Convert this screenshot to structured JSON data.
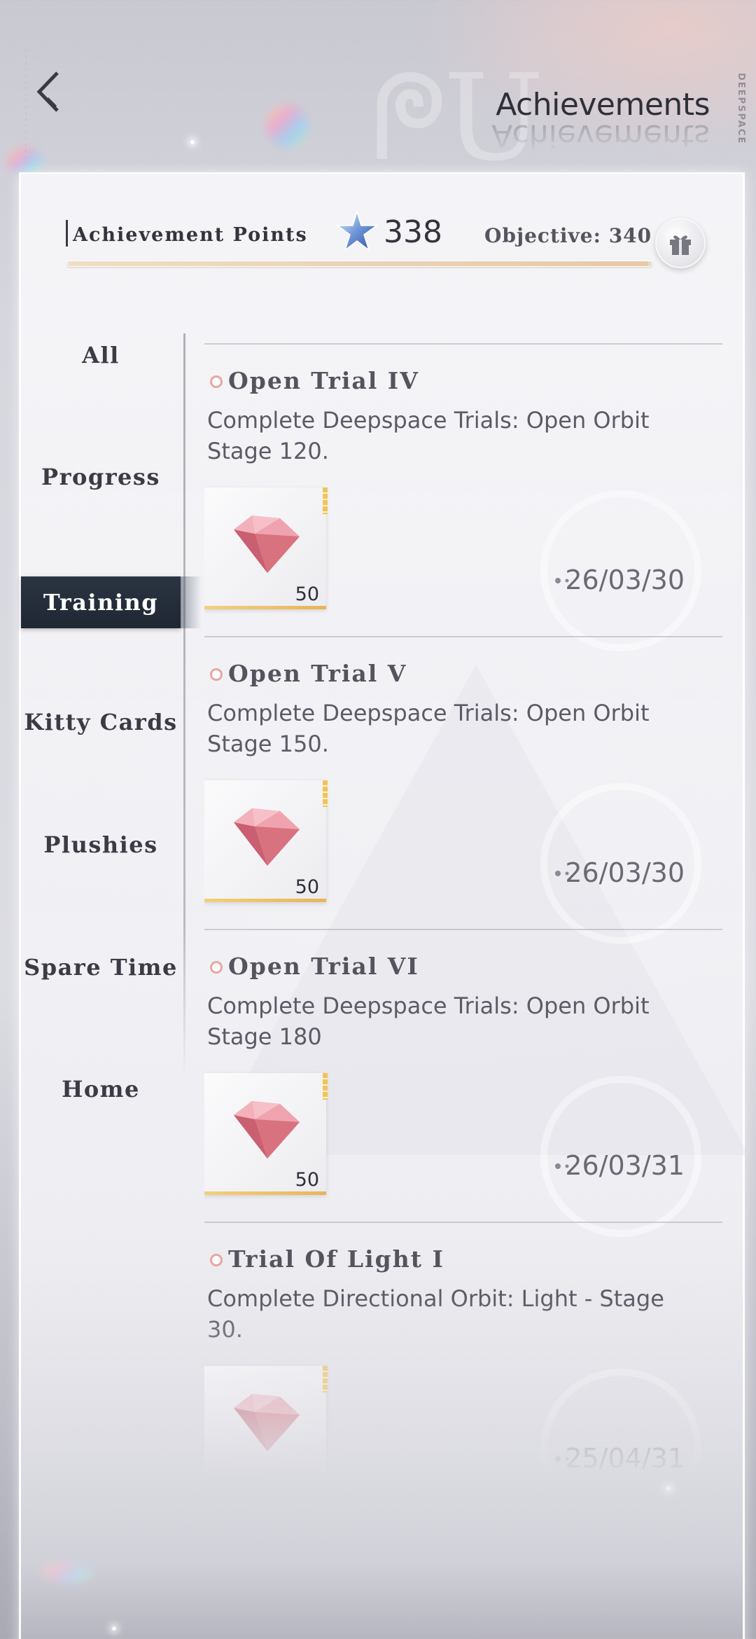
{
  "header": {
    "title": "Achievements",
    "brand": "DEEPSPACE"
  },
  "points": {
    "label": "Achievement Points",
    "value": "338",
    "objective": "Objective: 340",
    "progress_fraction": 0.994
  },
  "nav": {
    "items": [
      {
        "label": "All",
        "active": false
      },
      {
        "label": "Progress",
        "active": false
      },
      {
        "label": "Training",
        "active": true
      },
      {
        "label": "Kitty Cards",
        "active": false
      },
      {
        "label": "Plushies",
        "active": false
      },
      {
        "label": "Spare Time",
        "active": false
      },
      {
        "label": "Home",
        "active": false
      }
    ]
  },
  "achievements": [
    {
      "title": "Open Trial IV",
      "description": "Complete Deepspace Trials: Open Orbit Stage 120.",
      "reward_qty": "50",
      "reward_icon": "pink-diamond-icon",
      "date": "26/03/30"
    },
    {
      "title": "Open Trial V",
      "description": "Complete Deepspace Trials: Open Orbit Stage 150.",
      "reward_qty": "50",
      "reward_icon": "pink-diamond-icon",
      "date": "26/03/30"
    },
    {
      "title": "Open Trial VI",
      "description": "Complete Deepspace Trials: Open Orbit Stage 180",
      "reward_qty": "50",
      "reward_icon": "pink-diamond-icon",
      "date": "26/03/31"
    },
    {
      "title": "Trial Of Light I",
      "description": "Complete Directional Orbit: Light - Stage 30.",
      "reward_qty": "",
      "reward_icon": "pink-diamond-icon",
      "date": "25/04/31"
    }
  ],
  "colors": {
    "active_nav_bg": "#1f2733",
    "progress_fill": "#e7c9a8",
    "bullet": "#e7a6a0",
    "rarity_gold": "#f0c45a"
  }
}
